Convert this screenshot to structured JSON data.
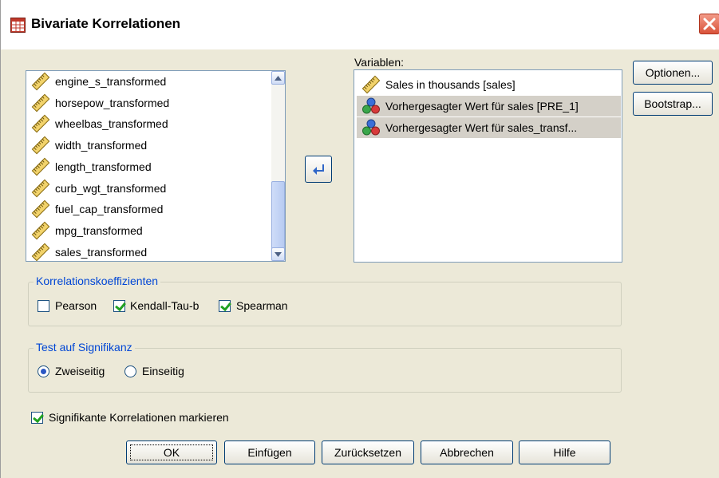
{
  "window": {
    "title": "Bivariate Korrelationen",
    "icon": "table-icon"
  },
  "source_list": {
    "items": [
      {
        "label": "engine_s_transformed",
        "icon": "ruler-icon"
      },
      {
        "label": "horsepow_transformed",
        "icon": "ruler-icon"
      },
      {
        "label": "wheelbas_transformed",
        "icon": "ruler-icon"
      },
      {
        "label": "width_transformed",
        "icon": "ruler-icon"
      },
      {
        "label": "length_transformed",
        "icon": "ruler-icon"
      },
      {
        "label": "curb_wgt_transformed",
        "icon": "ruler-icon"
      },
      {
        "label": "fuel_cap_transformed",
        "icon": "ruler-icon"
      },
      {
        "label": "mpg_transformed",
        "icon": "ruler-icon"
      },
      {
        "label": "sales_transformed",
        "icon": "ruler-icon"
      }
    ]
  },
  "variables": {
    "label": "Variablen:",
    "items": [
      {
        "label": "Sales in thousands [sales]",
        "icon": "ruler-icon",
        "selected": false
      },
      {
        "label": "Vorhergesagter Wert für sales [PRE_1]",
        "icon": "nominal-icon",
        "selected": true
      },
      {
        "label": "Vorhergesagter Wert für sales_transf...",
        "icon": "nominal-icon",
        "selected": true
      }
    ]
  },
  "side_buttons": {
    "options": "Optionen...",
    "bootstrap": "Bootstrap..."
  },
  "correlation": {
    "title": "Korrelationskoeffizienten",
    "pearson": {
      "label": "Pearson",
      "checked": false
    },
    "kendall": {
      "label": "Kendall-Tau-b",
      "checked": true
    },
    "spearman": {
      "label": "Spearman",
      "checked": true
    }
  },
  "significance": {
    "title": "Test auf Signifikanz",
    "two_sided": {
      "label": "Zweiseitig",
      "checked": true
    },
    "one_sided": {
      "label": "Einseitig",
      "checked": false
    }
  },
  "flag": {
    "label": "Signifikante Korrelationen markieren",
    "checked": true
  },
  "bottom_buttons": {
    "ok": "OK",
    "paste": "Einfügen",
    "reset": "Zurücksetzen",
    "cancel": "Abbrechen",
    "help": "Hilfe"
  },
  "colors": {
    "background": "#ece9d8",
    "selection": "#d4d0c8",
    "group_title": "#0046d5",
    "close_button": "#d9523a"
  }
}
